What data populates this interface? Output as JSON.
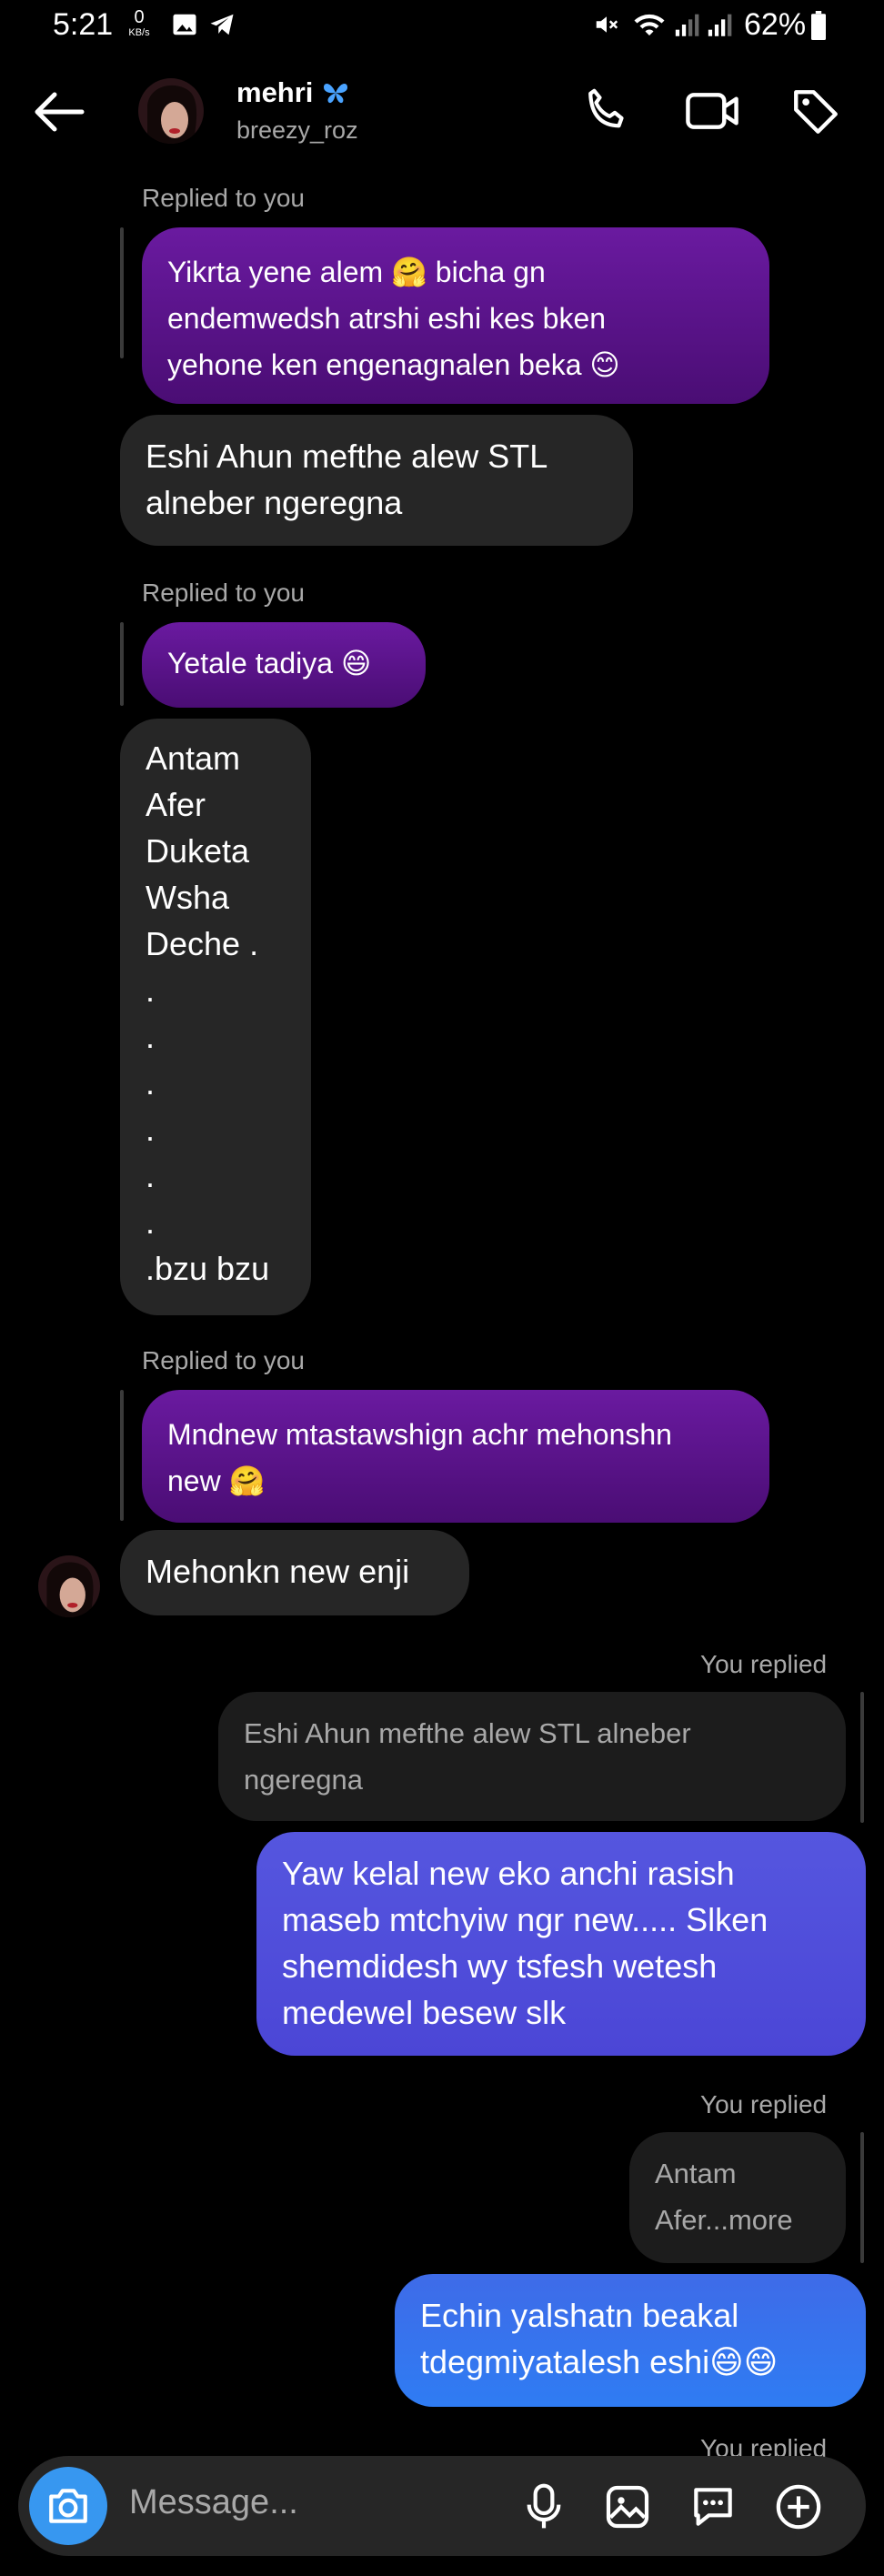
{
  "status": {
    "time": "5:21",
    "net_speed": "0",
    "net_unit": "KB/s",
    "battery": "62%"
  },
  "header": {
    "name": "mehri",
    "name_emoji": "butterfly",
    "username": "breezy_roz"
  },
  "messages": {
    "replied_to_you": "Replied to you",
    "you_replied": "You replied",
    "m1": "Yikrta yene alem 🤗 bicha gn\nendemwedsh atrshi eshi kes bken\nyehone ken engenagnalen beka 😊",
    "m2": "Eshi Ahun mefthe alew STL\nalneber ngeregna",
    "m3": "Yetale tadiya 😄",
    "m4": "Antam\nAfer\nDuketa\nWsha\nDeche .\n.\n.\n.\n.\n.\n.\n.bzu bzu",
    "m5": "Mndnew mtastawshign achr mehonshn\nnew 🤗",
    "m6": "Mehonkn new enji",
    "q1": "Eshi Ahun mefthe alew STL alneber\nngeregna",
    "m7": "Yaw kelal new eko anchi rasish\nmaseb mtchyiw ngr new..... Slken\nshemdidesh wy tsfesh wetesh\nmedewel besew slk",
    "q2": "Antam\nAfer...more",
    "m8": "Echin yalshatn beakal\ntdegmiyatalesh eshi😄😄"
  },
  "composer": {
    "placeholder": "Message..."
  },
  "colors": {
    "background": "#000000",
    "incoming": "#262626",
    "purple": "#5a1289",
    "outgoing_violet": "#5050db",
    "outgoing_blue": "#3478f0",
    "accent": "#3797f0"
  }
}
